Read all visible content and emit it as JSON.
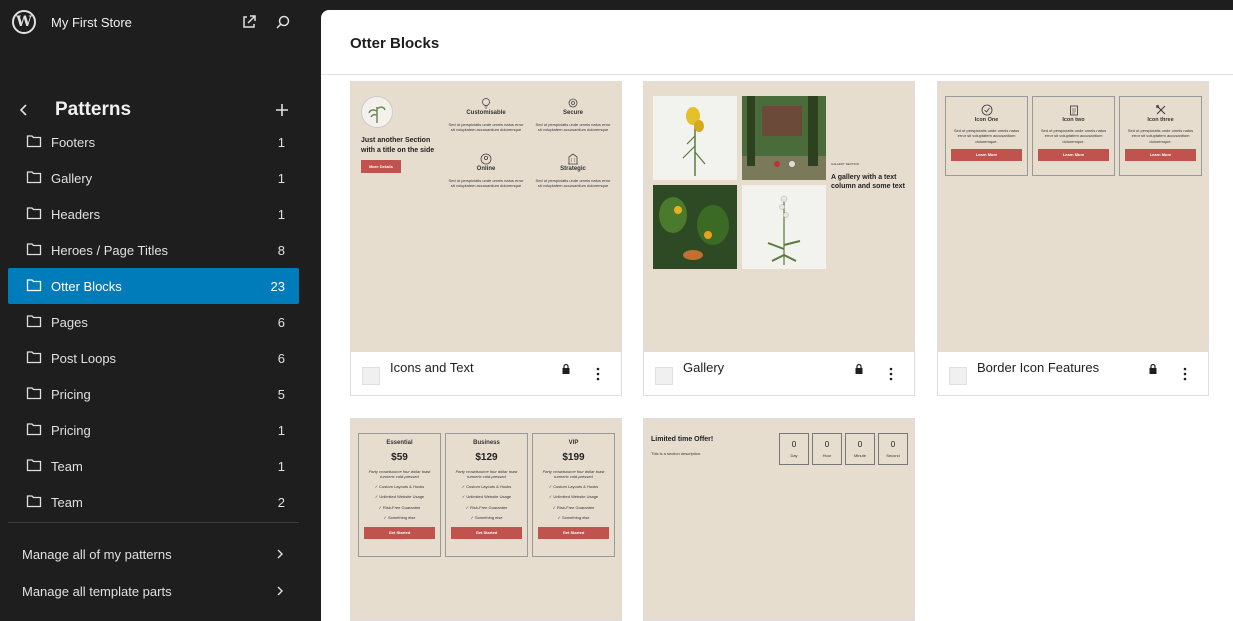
{
  "site": {
    "title": "My First Store"
  },
  "panel": {
    "title": "Patterns"
  },
  "categories": [
    {
      "label": "Footers",
      "count": "1"
    },
    {
      "label": "Gallery",
      "count": "1"
    },
    {
      "label": "Headers",
      "count": "1"
    },
    {
      "label": "Heroes / Page Titles",
      "count": "8"
    },
    {
      "label": "Otter Blocks",
      "count": "23"
    },
    {
      "label": "Pages",
      "count": "6"
    },
    {
      "label": "Post Loops",
      "count": "6"
    },
    {
      "label": "Pricing",
      "count": "5"
    },
    {
      "label": "Pricing",
      "count": "1"
    },
    {
      "label": "Team",
      "count": "1"
    },
    {
      "label": "Team",
      "count": "2"
    }
  ],
  "active_category_index": 4,
  "manage": {
    "patterns_label": "Manage all of my patterns",
    "template_parts_label": "Manage all template parts"
  },
  "main": {
    "title": "Otter Blocks",
    "cards": [
      {
        "title": "Icons and Text"
      },
      {
        "title": "Gallery"
      },
      {
        "title": "Border Icon Features"
      }
    ]
  },
  "previews": {
    "icons_text": {
      "heading": "Just another Section with a title on the side",
      "button": "More Details",
      "features": [
        {
          "title": "Customisable",
          "text": "Sed ut perspiciatis unde omnis natus error sit voluptatem accusantium doloremque"
        },
        {
          "title": "Secure",
          "text": "Sed ut perspiciatis unde omnis natus error sit voluptatem accusantium doloremque"
        },
        {
          "title": "Online",
          "text": "Sed ut perspiciatis unde omnis natus error sit voluptatem accusantium doloremque"
        },
        {
          "title": "Strategic",
          "text": "Sed ut perspiciatis unde omnis natus error sit voluptatem accusantium doloremque"
        }
      ]
    },
    "gallery": {
      "eyebrow": "GALLERY SECTION",
      "heading": "A gallery with a text column and some text"
    },
    "border_icons": {
      "items": [
        {
          "title": "Icon One",
          "text": "Sed ut perspiciatis unde omnis natus error sit voluptatem accusantium doloremque.",
          "button": "Learn More"
        },
        {
          "title": "Icon two",
          "text": "Sed ut perspiciatis unde omnis natus error sit voluptatem accusantium doloremque.",
          "button": "Learn More"
        },
        {
          "title": "Icon three",
          "text": "Sed ut perspiciatis unde omnis natus error sit voluptatem accusantium doloremque.",
          "button": "Learn More"
        }
      ]
    },
    "pricing": {
      "plans": [
        {
          "name": "Essential",
          "price": "$59",
          "tagline": "Party crowdsource four dollar toast turmeric cold-pressed",
          "features": [
            "Custom Layouts & Hooks",
            "Unlimited Website Usage",
            "Risk-Free Guarantee",
            "Something else"
          ],
          "button": "Get Started"
        },
        {
          "name": "Business",
          "price": "$129",
          "tagline": "Party crowdsource four dollar toast turmeric cold-pressed",
          "features": [
            "Custom Layouts & Hooks",
            "Unlimited Website Usage",
            "Risk-Free Guarantee",
            "Something else"
          ],
          "button": "Get Started"
        },
        {
          "name": "VIP",
          "price": "$199",
          "tagline": "Party crowdsource four dollar toast turmeric cold-pressed",
          "features": [
            "Custom Layouts & Hooks",
            "Unlimited Website Usage",
            "Risk-Free Guarantee",
            "Something else"
          ],
          "button": "Get Started"
        }
      ]
    },
    "countdown": {
      "heading": "Limited time Offer!",
      "description": "This is a section description.",
      "units": [
        {
          "value": "0",
          "label": "Day"
        },
        {
          "value": "0",
          "label": "Hour"
        },
        {
          "value": "0",
          "label": "Minute"
        },
        {
          "value": "0",
          "label": "Second"
        }
      ]
    }
  },
  "colors": {
    "accent": "#007cba",
    "sidebar_bg": "#1e1e1e",
    "preview_bg": "#e6ddcf",
    "button_red": "#c0534d"
  }
}
